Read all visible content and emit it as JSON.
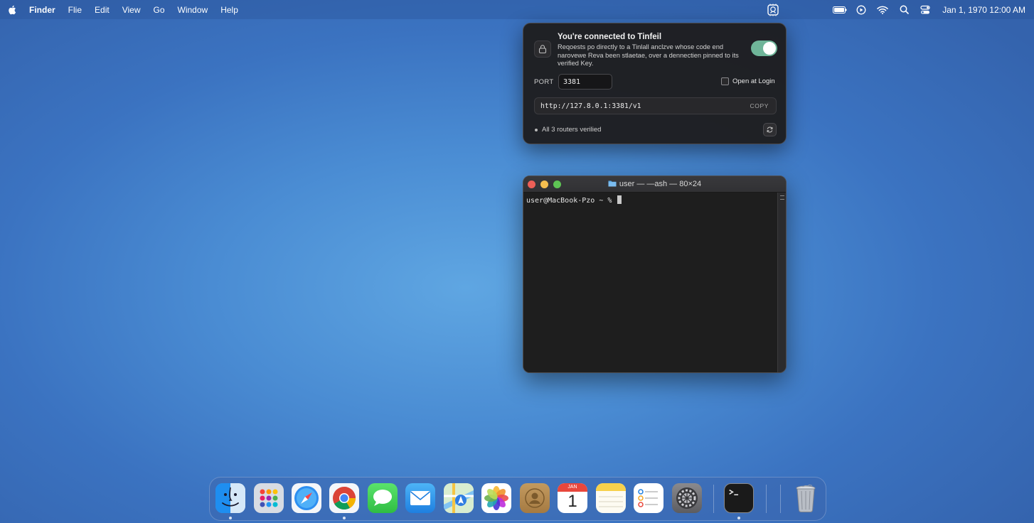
{
  "menubar": {
    "app_name": "Finder",
    "items": [
      "Flie",
      "Edit",
      "View",
      "Go",
      "Window",
      "Help"
    ],
    "clock": "Jan 1, 1970  12:00 AM",
    "status_icons": [
      "battery-icon",
      "play-circle-icon",
      "wifi-icon",
      "search-icon",
      "control-center-icon"
    ]
  },
  "tinfoil": {
    "title": "You're connected to Tinfeil",
    "description": "Reqoests po directly to a Tinlall anclzve whose code end narovewe Reva been stlaetae, over a dennectien pinned to its verified Key.",
    "toggle_on": true,
    "port_label": "PORT",
    "port_value": "3381",
    "open_at_login_label": "Open at Login",
    "open_at_login_checked": false,
    "url": "http://127.8.0.1:3381/v1",
    "copy_label": "COPY",
    "status": "All 3 routers verilied"
  },
  "terminal": {
    "title": "user — —ash — 80×24",
    "prompt": "user@MacBook-Pzo ~ % "
  },
  "dock": {
    "calendar_month": "JAN",
    "calendar_day": "1",
    "apps": [
      "Finder",
      "Launchpad",
      "Safari",
      "Chrome",
      "Messages",
      "Mail",
      "Maps",
      "Photos",
      "Contacts",
      "Calendar",
      "Notes",
      "Reminders",
      "System Settings",
      "Terminal",
      "Trash"
    ]
  },
  "colors": {
    "toggle_on": "#6fb599",
    "desktop_center": "#5fa6e2",
    "desktop_edge": "#3463ad"
  }
}
